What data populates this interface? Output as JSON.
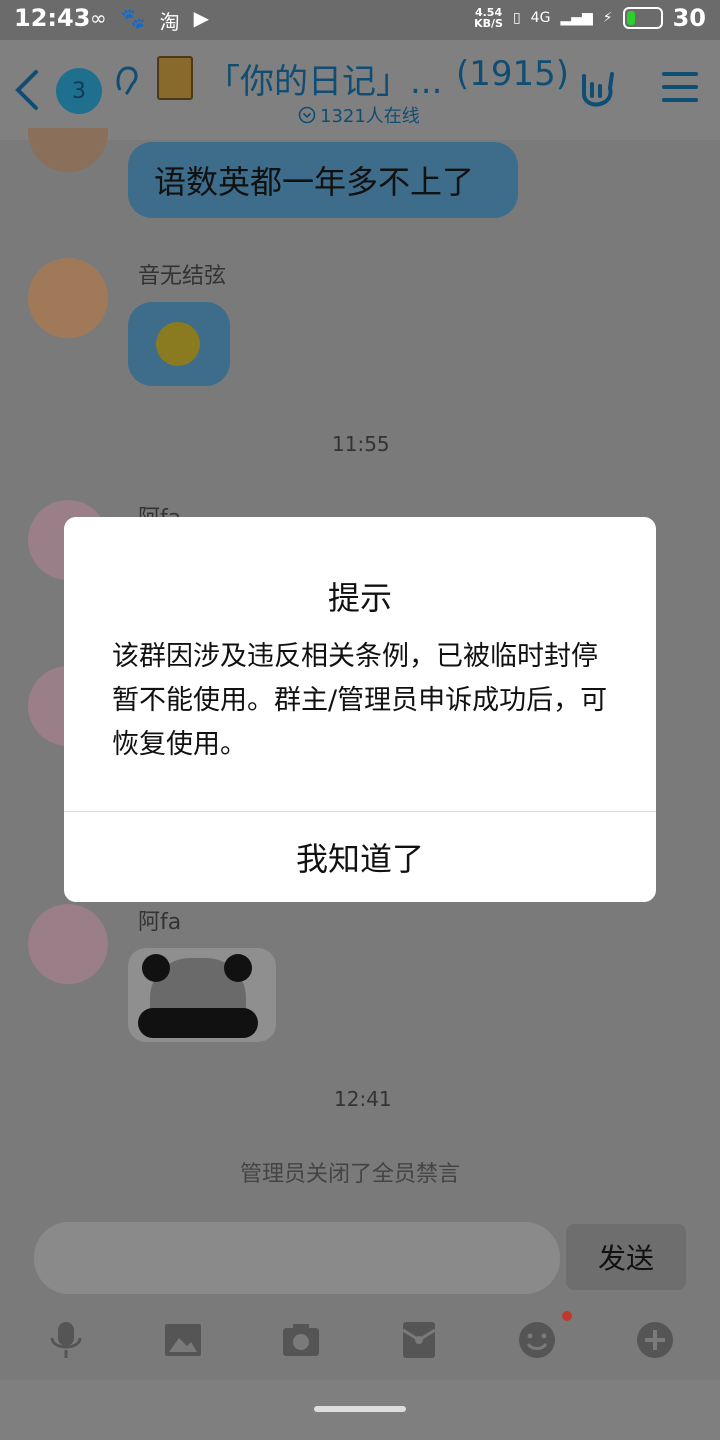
{
  "status_bar": {
    "time": "12:43",
    "icons_left": [
      "∞",
      "🐾",
      "淘",
      "▶"
    ],
    "speed_top": "4.54",
    "speed_bottom": "KB/S",
    "network": "4G",
    "battery": "30"
  },
  "header": {
    "badge_count": "3",
    "title": "「你的日记」...",
    "member_count": "(1915)",
    "online_text": "1321人在线"
  },
  "messages": {
    "msg1_text": "语数英都一年多不上了",
    "msg2_sender": "音无结弦",
    "time1": "11:55",
    "msg3_sender": "阿fa",
    "msg4_sender": "阿fa",
    "time2": "12:41",
    "system_notice": "管理员关闭了全员禁言"
  },
  "dialog": {
    "title": "提示",
    "body": "该群因涉及违反相关条例，已被临时封停暂不能使用。群主/管理员申诉成功后，可恢复使用。",
    "button": "我知道了"
  },
  "input_bar": {
    "placeholder": "",
    "send_label": "发送"
  },
  "toolbar_icons": [
    "microphone-icon",
    "image-icon",
    "camera-icon",
    "red-packet-icon",
    "emoji-icon",
    "plus-icon"
  ],
  "colors": {
    "accent": "#0f4d73",
    "overlay": "#7a7a7a",
    "notification_dot": "#c0392b"
  }
}
